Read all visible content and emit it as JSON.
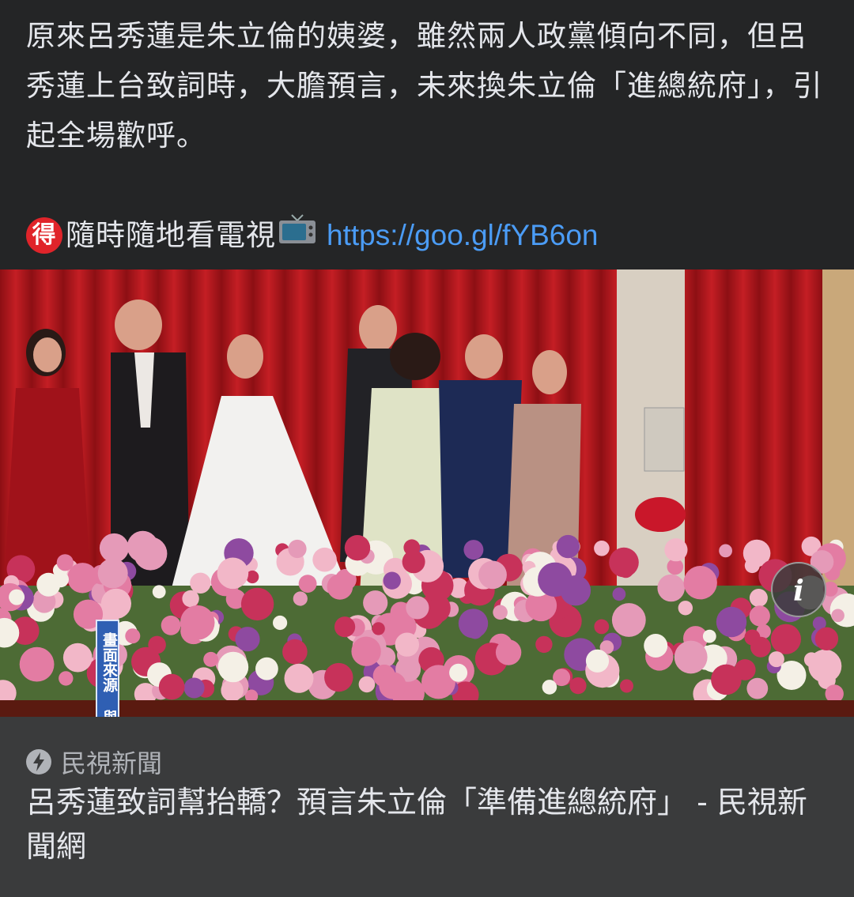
{
  "post": {
    "text": "原來呂秀蓮是朱立倫的姨婆，雖然兩人政黨傾向不同，但呂秀蓮上台致詞時，大膽預言，未來換朱立倫「進總統府」，引起全場歡呼。",
    "promo_badge": "得",
    "promo_text": "隨時隨地看電視",
    "link": "https://goo.gl/fYB6on"
  },
  "photo": {
    "caption_vertical": "畫面來源 與會人提供",
    "info_label": "i"
  },
  "preview": {
    "source": "民視新聞",
    "title": "呂秀蓮致詞幫抬轎？預言朱立倫「準備進總統府」 - 民視新聞網"
  }
}
